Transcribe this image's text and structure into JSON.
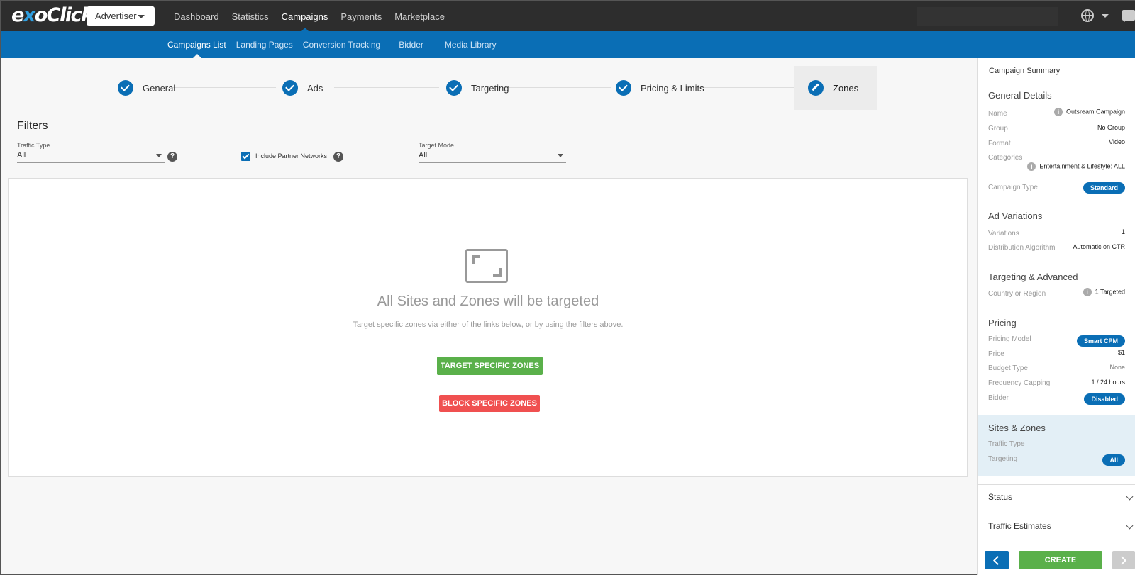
{
  "brand": {
    "logo_pre": "e",
    "logo_x": "x",
    "logo_post": "oClick"
  },
  "role_select": {
    "value": "Advertiser"
  },
  "top_nav": [
    {
      "label": "Dashboard"
    },
    {
      "label": "Statistics"
    },
    {
      "label": "Campaigns",
      "active": true
    },
    {
      "label": "Payments"
    },
    {
      "label": "Marketplace"
    }
  ],
  "sub_nav": [
    {
      "label": "Campaigns List",
      "active": true
    },
    {
      "label": "Landing Pages"
    },
    {
      "label": "Conversion Tracking"
    },
    {
      "label": "Bidder"
    },
    {
      "label": "Media Library"
    }
  ],
  "steps": [
    {
      "label": "General",
      "state": "done"
    },
    {
      "label": "Ads",
      "state": "done"
    },
    {
      "label": "Targeting",
      "state": "done"
    },
    {
      "label": "Pricing & Limits",
      "state": "done"
    },
    {
      "label": "Zones",
      "state": "current"
    }
  ],
  "filters": {
    "title": "Filters",
    "traffic_type_label": "Traffic Type",
    "traffic_type_value": "All",
    "partner_networks_label": "Include Partner Networks",
    "partner_networks_checked": true,
    "target_mode_label": "Target Mode",
    "target_mode_value": "All",
    "help_glyph": "?"
  },
  "empty_state": {
    "title": "All Sites and Zones will be targeted",
    "subtitle": "Target specific zones via either of the links below, or by using the filters above.",
    "target_button": "TARGET SPECIFIC ZONES",
    "block_button": "BLOCK SPECIFIC ZONES"
  },
  "summary": {
    "header": "Campaign Summary",
    "general": {
      "title": "General Details",
      "name_label": "Name",
      "name_value": "Outsream Campaign",
      "group_label": "Group",
      "group_value": "No Group",
      "format_label": "Format",
      "format_value": "Video",
      "categories_label": "Categories",
      "categories_value": "Entertainment & Lifestyle: ALL",
      "campaign_type_label": "Campaign Type",
      "campaign_type_value": "Standard"
    },
    "ad_variations": {
      "title": "Ad Variations",
      "variations_label": "Variations",
      "variations_value": "1",
      "algorithm_label": "Distribution Algorithm",
      "algorithm_value": "Automatic on CTR"
    },
    "targeting": {
      "title": "Targeting & Advanced",
      "country_label": "Country or Region",
      "country_value": "1 Targeted"
    },
    "pricing": {
      "title": "Pricing",
      "model_label": "Pricing Model",
      "model_value": "Smart CPM",
      "price_label": "Price",
      "price_value": "$1",
      "budget_label": "Budget Type",
      "budget_value": "None",
      "frequency_label": "Frequency Capping",
      "frequency_value": "1 / 24 hours",
      "bidder_label": "Bidder",
      "bidder_value": "Disabled"
    },
    "sites_zones": {
      "title": "Sites & Zones",
      "traffic_type_label": "Traffic Type",
      "targeting_label": "Targeting",
      "targeting_value": "All"
    },
    "status_title": "Status",
    "traffic_estimates_title": "Traffic Estimates",
    "info_glyph": "i"
  },
  "footer": {
    "create_label": "CREATE"
  },
  "colors": {
    "brand_blue": "#0a6eb5",
    "green": "#5ab04a",
    "red": "#f05050",
    "topbar": "#2d2d2d"
  }
}
